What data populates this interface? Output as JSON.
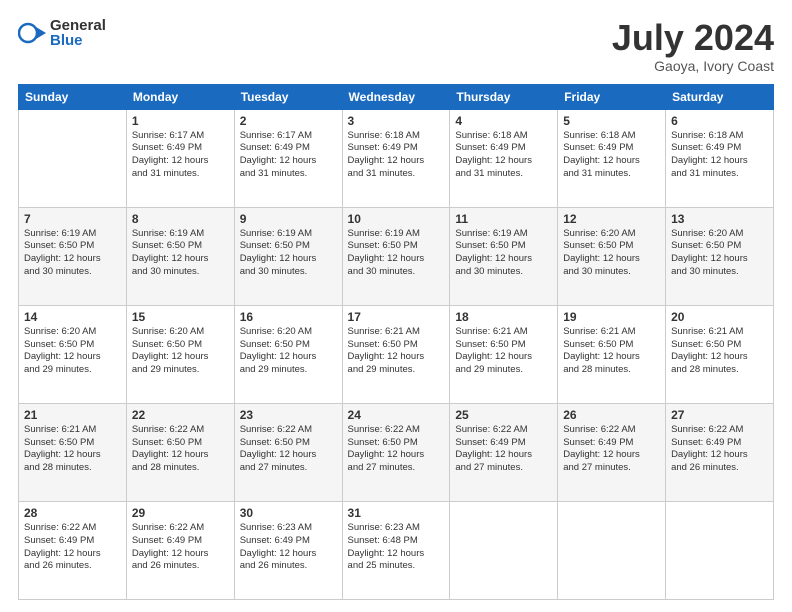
{
  "header": {
    "logo_general": "General",
    "logo_blue": "Blue",
    "month_title": "July 2024",
    "location": "Gaoya, Ivory Coast"
  },
  "weekdays": [
    "Sunday",
    "Monday",
    "Tuesday",
    "Wednesday",
    "Thursday",
    "Friday",
    "Saturday"
  ],
  "weeks": [
    [
      {
        "day": "",
        "info": ""
      },
      {
        "day": "1",
        "info": "Sunrise: 6:17 AM\nSunset: 6:49 PM\nDaylight: 12 hours\nand 31 minutes."
      },
      {
        "day": "2",
        "info": "Sunrise: 6:17 AM\nSunset: 6:49 PM\nDaylight: 12 hours\nand 31 minutes."
      },
      {
        "day": "3",
        "info": "Sunrise: 6:18 AM\nSunset: 6:49 PM\nDaylight: 12 hours\nand 31 minutes."
      },
      {
        "day": "4",
        "info": "Sunrise: 6:18 AM\nSunset: 6:49 PM\nDaylight: 12 hours\nand 31 minutes."
      },
      {
        "day": "5",
        "info": "Sunrise: 6:18 AM\nSunset: 6:49 PM\nDaylight: 12 hours\nand 31 minutes."
      },
      {
        "day": "6",
        "info": "Sunrise: 6:18 AM\nSunset: 6:49 PM\nDaylight: 12 hours\nand 31 minutes."
      }
    ],
    [
      {
        "day": "7",
        "info": "Sunrise: 6:19 AM\nSunset: 6:50 PM\nDaylight: 12 hours\nand 30 minutes."
      },
      {
        "day": "8",
        "info": "Sunrise: 6:19 AM\nSunset: 6:50 PM\nDaylight: 12 hours\nand 30 minutes."
      },
      {
        "day": "9",
        "info": "Sunrise: 6:19 AM\nSunset: 6:50 PM\nDaylight: 12 hours\nand 30 minutes."
      },
      {
        "day": "10",
        "info": "Sunrise: 6:19 AM\nSunset: 6:50 PM\nDaylight: 12 hours\nand 30 minutes."
      },
      {
        "day": "11",
        "info": "Sunrise: 6:19 AM\nSunset: 6:50 PM\nDaylight: 12 hours\nand 30 minutes."
      },
      {
        "day": "12",
        "info": "Sunrise: 6:20 AM\nSunset: 6:50 PM\nDaylight: 12 hours\nand 30 minutes."
      },
      {
        "day": "13",
        "info": "Sunrise: 6:20 AM\nSunset: 6:50 PM\nDaylight: 12 hours\nand 30 minutes."
      }
    ],
    [
      {
        "day": "14",
        "info": "Sunrise: 6:20 AM\nSunset: 6:50 PM\nDaylight: 12 hours\nand 29 minutes."
      },
      {
        "day": "15",
        "info": "Sunrise: 6:20 AM\nSunset: 6:50 PM\nDaylight: 12 hours\nand 29 minutes."
      },
      {
        "day": "16",
        "info": "Sunrise: 6:20 AM\nSunset: 6:50 PM\nDaylight: 12 hours\nand 29 minutes."
      },
      {
        "day": "17",
        "info": "Sunrise: 6:21 AM\nSunset: 6:50 PM\nDaylight: 12 hours\nand 29 minutes."
      },
      {
        "day": "18",
        "info": "Sunrise: 6:21 AM\nSunset: 6:50 PM\nDaylight: 12 hours\nand 29 minutes."
      },
      {
        "day": "19",
        "info": "Sunrise: 6:21 AM\nSunset: 6:50 PM\nDaylight: 12 hours\nand 28 minutes."
      },
      {
        "day": "20",
        "info": "Sunrise: 6:21 AM\nSunset: 6:50 PM\nDaylight: 12 hours\nand 28 minutes."
      }
    ],
    [
      {
        "day": "21",
        "info": "Sunrise: 6:21 AM\nSunset: 6:50 PM\nDaylight: 12 hours\nand 28 minutes."
      },
      {
        "day": "22",
        "info": "Sunrise: 6:22 AM\nSunset: 6:50 PM\nDaylight: 12 hours\nand 28 minutes."
      },
      {
        "day": "23",
        "info": "Sunrise: 6:22 AM\nSunset: 6:50 PM\nDaylight: 12 hours\nand 27 minutes."
      },
      {
        "day": "24",
        "info": "Sunrise: 6:22 AM\nSunset: 6:50 PM\nDaylight: 12 hours\nand 27 minutes."
      },
      {
        "day": "25",
        "info": "Sunrise: 6:22 AM\nSunset: 6:49 PM\nDaylight: 12 hours\nand 27 minutes."
      },
      {
        "day": "26",
        "info": "Sunrise: 6:22 AM\nSunset: 6:49 PM\nDaylight: 12 hours\nand 27 minutes."
      },
      {
        "day": "27",
        "info": "Sunrise: 6:22 AM\nSunset: 6:49 PM\nDaylight: 12 hours\nand 26 minutes."
      }
    ],
    [
      {
        "day": "28",
        "info": "Sunrise: 6:22 AM\nSunset: 6:49 PM\nDaylight: 12 hours\nand 26 minutes."
      },
      {
        "day": "29",
        "info": "Sunrise: 6:22 AM\nSunset: 6:49 PM\nDaylight: 12 hours\nand 26 minutes."
      },
      {
        "day": "30",
        "info": "Sunrise: 6:23 AM\nSunset: 6:49 PM\nDaylight: 12 hours\nand 26 minutes."
      },
      {
        "day": "31",
        "info": "Sunrise: 6:23 AM\nSunset: 6:48 PM\nDaylight: 12 hours\nand 25 minutes."
      },
      {
        "day": "",
        "info": ""
      },
      {
        "day": "",
        "info": ""
      },
      {
        "day": "",
        "info": ""
      }
    ]
  ]
}
